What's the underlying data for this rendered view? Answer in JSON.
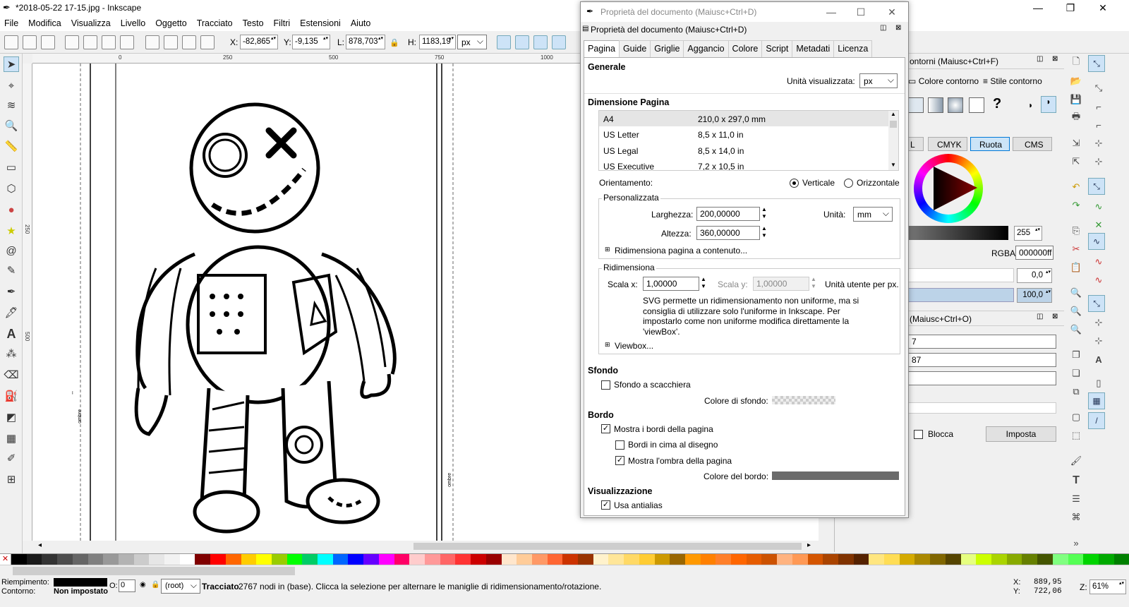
{
  "window": {
    "title": "*2018-05-22 17-15.jpg - Inkscape"
  },
  "menu": [
    "File",
    "Modifica",
    "Visualizza",
    "Livello",
    "Oggetto",
    "Tracciato",
    "Testo",
    "Filtri",
    "Estensioni",
    "Aiuto"
  ],
  "toolbar": {
    "x_label": "X:",
    "x_value": "-82,865",
    "y_label": "Y:",
    "y_value": "-9,135",
    "w_label": "L:",
    "w_value": "878,703",
    "h_label": "H:",
    "h_value": "1183,19",
    "unit": "px"
  },
  "ruler": {
    "h_ticks": [
      "0",
      "250",
      "500",
      "750",
      "1000"
    ],
    "v_ticks": [
      "250",
      "500"
    ]
  },
  "canvas": {
    "shadow_label_left": "ombre",
    "shadow_label_right": "ombre"
  },
  "dialog": {
    "title": "Proprietà del documento (Maiusc+Ctrl+D)",
    "header": "Proprietà del documento (Maiusc+Ctrl+D)",
    "tabs": [
      "Pagina",
      "Guide",
      "Griglie",
      "Aggancio",
      "Colore",
      "Script",
      "Metadati",
      "Licenza"
    ],
    "general": {
      "heading": "Generale",
      "display_units_label": "Unità visualizzata:",
      "display_units": "px"
    },
    "page_size": {
      "heading": "Dimensione Pagina",
      "rows": [
        {
          "name": "A4",
          "size": "210,0 x 297,0 mm"
        },
        {
          "name": "US Letter",
          "size": "8,5 x 11,0 in"
        },
        {
          "name": "US Legal",
          "size": "8,5 x 14,0 in"
        },
        {
          "name": "US Executive",
          "size": "7,2 x 10,5 in"
        }
      ],
      "orientation_label": "Orientamento:",
      "portrait": "Verticale",
      "landscape": "Orizzontale"
    },
    "custom": {
      "legend": "Personalizzata",
      "width_label": "Larghezza:",
      "width": "200,00000",
      "height_label": "Altezza:",
      "height": "360,00000",
      "units_label": "Unità:",
      "units": "mm",
      "resize_to_content": "Ridimensiona pagina a contenuto..."
    },
    "scale": {
      "legend": "Ridimensiona",
      "scale_x_label": "Scala x:",
      "scale_x": "1,00000",
      "scale_y_label": "Scala y:",
      "scale_y": "1,00000",
      "user_units": "Unità utente per px.",
      "note": "SVG permette un ridimensionamento non uniforme, ma si consiglia di utilizzare solo l'uniforme in Inkscape. Per impostarlo come non uniforme modifica direttamente la 'viewBox'.",
      "viewbox": "Viewbox..."
    },
    "background": {
      "heading": "Sfondo",
      "checkerboard": "Sfondo a scacchiera",
      "bg_color_label": "Colore di sfondo:"
    },
    "border": {
      "heading": "Bordo",
      "show_border": "Mostra i bordi della pagina",
      "border_on_top": "Bordi in cima al disegno",
      "show_shadow": "Mostra l'ombra della pagina",
      "border_color_label": "Colore del bordo:",
      "border_color": "#6b6b6b"
    },
    "display": {
      "heading": "Visualizzazione",
      "antialias": "Usa antialias"
    }
  },
  "fill_stroke": {
    "title": "ontorni (Maiusc+Ctrl+F)",
    "tab_stroke_paint": "Colore contorno",
    "tab_stroke_style": "Stile contorno",
    "modes": [
      "L",
      "CMYK",
      "Ruota",
      "CMS"
    ],
    "alpha": "255",
    "rgba_label": "RGBA:",
    "rgba": "000000ff",
    "blur": "0,0",
    "opacity": "100,0"
  },
  "object_panel": {
    "title": "(Maiusc+Ctrl+O)",
    "field1": "7",
    "field2": "87",
    "lock_label": "Blocca",
    "set_button": "Imposta"
  },
  "status": {
    "fill_label": "Riempimento:",
    "stroke_label": "Contorno:",
    "stroke_value": "Non impostato",
    "o_label": "O:",
    "o_value": "0",
    "layer": "(root)",
    "message_bold": "Tracciato",
    "message": " 2767 nodi in (base). Clicca la selezione per alternare le maniglie di ridimensionamento/rotazione.",
    "x_label": "X:",
    "x": "889,95",
    "y_label": "Y:",
    "y": "722,06",
    "zoom_label": "Z:",
    "zoom": "61%"
  },
  "palette_colors": [
    "#000000",
    "#1a1a1a",
    "#333333",
    "#4d4d4d",
    "#666666",
    "#808080",
    "#999999",
    "#b3b3b3",
    "#cccccc",
    "#e6e6e6",
    "#f2f2f2",
    "#ffffff",
    "#800000",
    "#ff0000",
    "#ff6600",
    "#ffcc00",
    "#ffff00",
    "#99cc00",
    "#00ff00",
    "#00cc66",
    "#00ffff",
    "#0066ff",
    "#0000ff",
    "#6600ff",
    "#ff00ff",
    "#ff0066",
    "#ffcccc",
    "#ff9999",
    "#ff6666",
    "#ff3333",
    "#cc0000",
    "#990000",
    "#ffe6cc",
    "#ffcc99",
    "#ff9966",
    "#ff6633",
    "#cc3300",
    "#993300",
    "#fff2cc",
    "#ffe699",
    "#ffd966",
    "#ffcc33",
    "#cc9900",
    "#996600",
    "#ff9900",
    "#ff8000",
    "#ff7f2a",
    "#ff6600",
    "#e65c00",
    "#cc5200",
    "#ffb380",
    "#ff9955",
    "#d45500",
    "#aa4400",
    "#803300",
    "#552200",
    "#ffe680",
    "#ffdd55",
    "#d4aa00",
    "#aa8800",
    "#806600",
    "#554400",
    "#e6ff80",
    "#ccff00",
    "#aad400",
    "#88aa00",
    "#668000",
    "#445500",
    "#80ff80",
    "#55ff55",
    "#00d400",
    "#00aa00",
    "#008000"
  ]
}
